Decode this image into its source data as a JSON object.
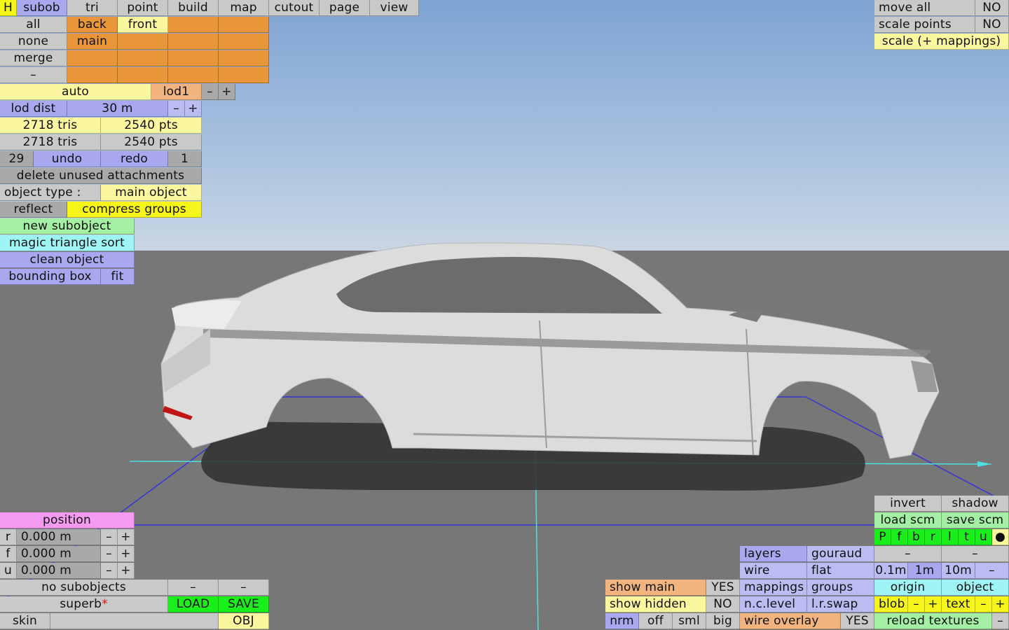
{
  "colors": {
    "sky": "#7ea3d2",
    "ground": "#777777",
    "axis": "#4ee0e0",
    "grid": "#3535d5"
  },
  "menu": {
    "h": "H",
    "tabs": [
      "subob",
      "tri",
      "point",
      "build",
      "map",
      "cutout",
      "page",
      "view"
    ]
  },
  "select": {
    "all": "all",
    "none": "none",
    "merge": "merge",
    "dash": "–"
  },
  "subobjects": {
    "back": "back",
    "front": "front",
    "main": "main"
  },
  "lod": {
    "auto": "auto",
    "level": "lod1",
    "minus": "–",
    "plus": "+",
    "dist_label": "lod dist",
    "dist_value": "30 m"
  },
  "stats": {
    "tris1": "2718 tris",
    "pts1": "2540 pts",
    "tris2": "2718 tris",
    "pts2": "2540 pts"
  },
  "history": {
    "count": "29",
    "undo": "undo",
    "redo": "redo",
    "redo_count": "1"
  },
  "actions": {
    "delete_unused": "delete unused attachments",
    "object_type_label": "object type :",
    "object_type_value": "main object",
    "reflect": "reflect",
    "compress": "compress groups",
    "new_sub": "new subobject",
    "magic": "magic triangle sort",
    "clean": "clean object",
    "bbox": "bounding box",
    "fit": "fit"
  },
  "topright": {
    "move_all": "move all",
    "move_val": "NO",
    "scale_points": "scale points",
    "scale_val": "NO",
    "scale_map": "scale (+ mappings)"
  },
  "position": {
    "title": "position",
    "rows": [
      {
        "axis": "r",
        "value": "0.000 m",
        "minus": "–",
        "plus": "+"
      },
      {
        "axis": "f",
        "value": "0.000 m",
        "minus": "–",
        "plus": "+"
      },
      {
        "axis": "u",
        "value": "0.000 m",
        "minus": "–",
        "plus": "+"
      }
    ]
  },
  "bottomleft": {
    "no_sub": "no subobjects",
    "dash1": "–",
    "dash2": "–",
    "file": "superb",
    "modified": "*",
    "load": "LOAD",
    "save": "SAVE",
    "skin": "skin",
    "obj": "OBJ"
  },
  "display": {
    "show_main": "show main",
    "show_main_val": "YES",
    "show_hidden": "show hidden",
    "show_hidden_val": "NO",
    "nrm": "nrm",
    "off": "off",
    "sml": "sml",
    "big": "big",
    "layers": "layers",
    "gouraud": "gouraud",
    "wire": "wire",
    "flat": "flat",
    "mappings": "mappings",
    "groups": "groups",
    "nclevel": "n.c.level",
    "lrswap": "l.r.swap",
    "wire_overlay": "wire overlay",
    "wire_overlay_val": "YES"
  },
  "br": {
    "invert": "invert",
    "shadow": "shadow",
    "load_scm": "load scm",
    "save_scm": "save scm",
    "views": [
      "P",
      "f",
      "b",
      "r",
      "l",
      "t",
      "u",
      "●"
    ],
    "dash_a": "–",
    "dash_b": "–",
    "step1": "0.1m",
    "step2": "1m",
    "step3": "10m",
    "step_minus": "–",
    "origin": "origin",
    "object": "object",
    "blob": "blob",
    "blob_minus": "–",
    "blob_plus": "+",
    "text": "text",
    "text_minus": "–",
    "text_plus": "+",
    "reload": "reload textures",
    "reload_minus": "–"
  }
}
